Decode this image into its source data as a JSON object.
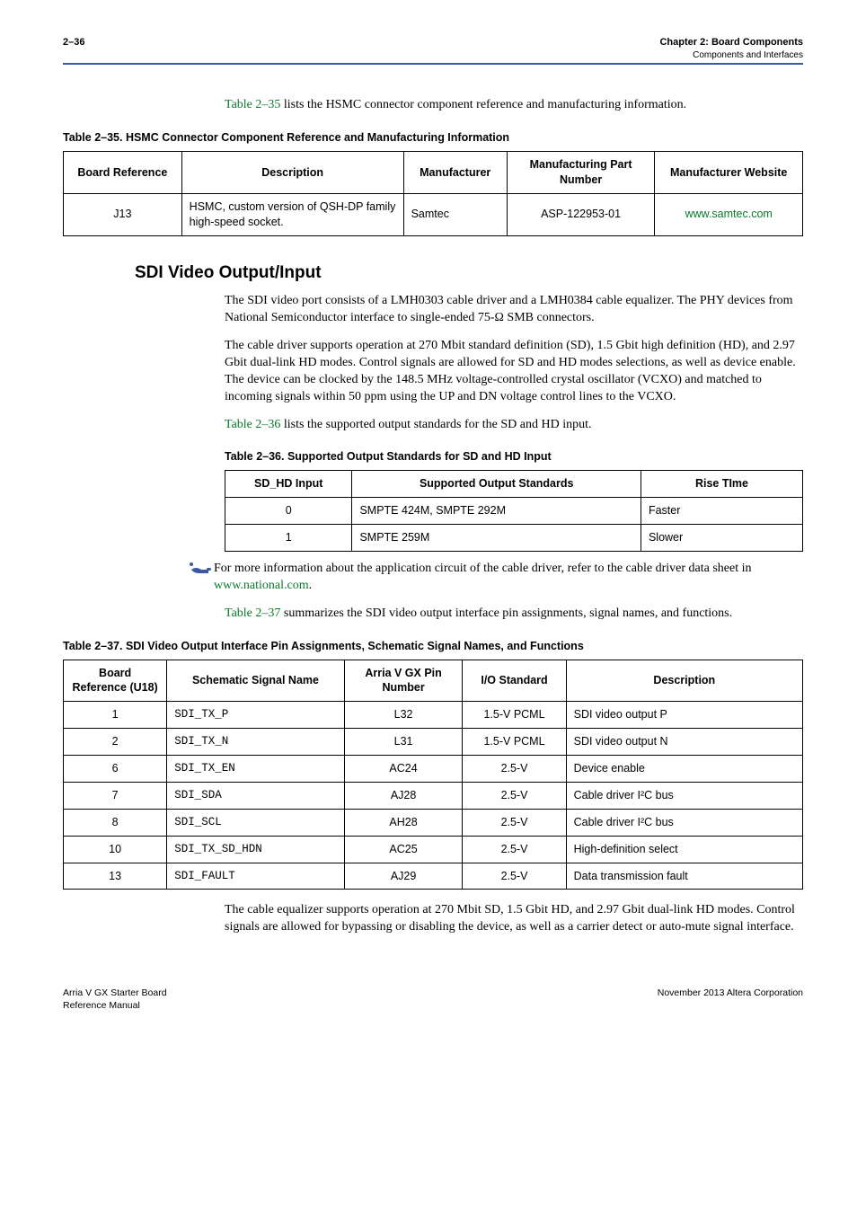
{
  "header": {
    "page_no": "2–36",
    "chapter_line": "Chapter 2: Board Components",
    "sub_line": "Components and Interfaces"
  },
  "intro": {
    "para": "Table 2–35 lists the HSMC connector component reference and manufacturing information."
  },
  "table35": {
    "caption": "Table 2–35.  HSMC Connector Component Reference and Manufacturing Information",
    "heads": {
      "c1": "Board Reference",
      "c2": "Description",
      "c3": "Manufacturer",
      "c4": "Manufacturing Part Number",
      "c5": "Manufacturer Website"
    },
    "row": {
      "c1": "J13",
      "c2": "HSMC, custom version of QSH-DP family high-speed socket.",
      "c3": "Samtec",
      "c4": "ASP-122953-01",
      "c5": "www.samtec.com"
    }
  },
  "section_title": "SDI Video Output/Input",
  "paras": {
    "p1": "The SDI video port consists of a LMH0303 cable driver and a LMH0384 cable equalizer. The PHY devices from National Semiconductor interface to single-ended 75-Ω SMB connectors.",
    "p2": "The cable driver supports operation at 270 Mbit standard definition (SD), 1.5 Gbit high definition (HD), and 2.97 Gbit dual-link HD modes. Control signals are allowed for SD and HD modes selections, as well as device enable. The device can be clocked by the 148.5 MHz voltage-controlled crystal oscillator (VCXO) and matched to incoming signals within 50 ppm using the UP and DN voltage control lines to the VCXO.",
    "p3_a": "Table 2–36",
    "p3_b": " lists the supported output standards for the SD and HD input."
  },
  "table36": {
    "caption": "Table 2–36.  Supported Output Standards for SD and HD Input",
    "heads": {
      "c1": "SD_HD Input",
      "c2": "Supported Output Standards",
      "c3": "Rise TIme"
    },
    "rows": [
      {
        "c1": "0",
        "c2": "SMPTE 424M, SMPTE 292M",
        "c3": "Faster"
      },
      {
        "c1": "1",
        "c2": "SMPTE 259M",
        "c3": "Slower"
      }
    ]
  },
  "note": {
    "text_a": "For more information about the application circuit of the cable driver, refer to the cable driver data sheet in ",
    "link": "www.national.com",
    "text_b": "."
  },
  "para4_a": "Table 2–37",
  "para4_b": " summarizes the SDI video output interface pin assignments, signal names, and functions.",
  "table37": {
    "caption": "Table 2–37.  SDI Video Output Interface Pin Assignments, Schematic Signal Names, and Functions",
    "heads": {
      "c1": "Board Reference (U18)",
      "c2": "Schematic Signal Name",
      "c3": "Arria V GX Pin Number",
      "c4": "I/O Standard",
      "c5": "Description"
    },
    "rows": [
      {
        "c1": "1",
        "c2": "SDI_TX_P",
        "c3": "L32",
        "c4": "1.5-V PCML",
        "c5": "SDI video output P"
      },
      {
        "c1": "2",
        "c2": "SDI_TX_N",
        "c3": "L31",
        "c4": "1.5-V PCML",
        "c5": "SDI video output N"
      },
      {
        "c1": "6",
        "c2": "SDI_TX_EN",
        "c3": "AC24",
        "c4": "2.5-V",
        "c5": "Device enable"
      },
      {
        "c1": "7",
        "c2": "SDI_SDA",
        "c3": "AJ28",
        "c4": "2.5-V",
        "c5": "Cable driver I²C bus"
      },
      {
        "c1": "8",
        "c2": "SDI_SCL",
        "c3": "AH28",
        "c4": "2.5-V",
        "c5": "Cable driver I²C bus"
      },
      {
        "c1": "10",
        "c2": "SDI_TX_SD_HDN",
        "c3": "AC25",
        "c4": "2.5-V",
        "c5": "High-definition select"
      },
      {
        "c1": "13",
        "c2": "SDI_FAULT",
        "c3": "AJ29",
        "c4": "2.5-V",
        "c5": "Data transmission fault"
      }
    ]
  },
  "para5": "The cable equalizer supports operation at 270 Mbit SD, 1.5 Gbit HD, and 2.97 Gbit dual-link HD modes. Control signals are allowed for bypassing or disabling the device, as well as a carrier detect or auto-mute signal interface.",
  "footer": {
    "left1": "Arria V GX Starter Board",
    "left2": "Reference Manual",
    "right": "November 2013   Altera Corporation"
  }
}
